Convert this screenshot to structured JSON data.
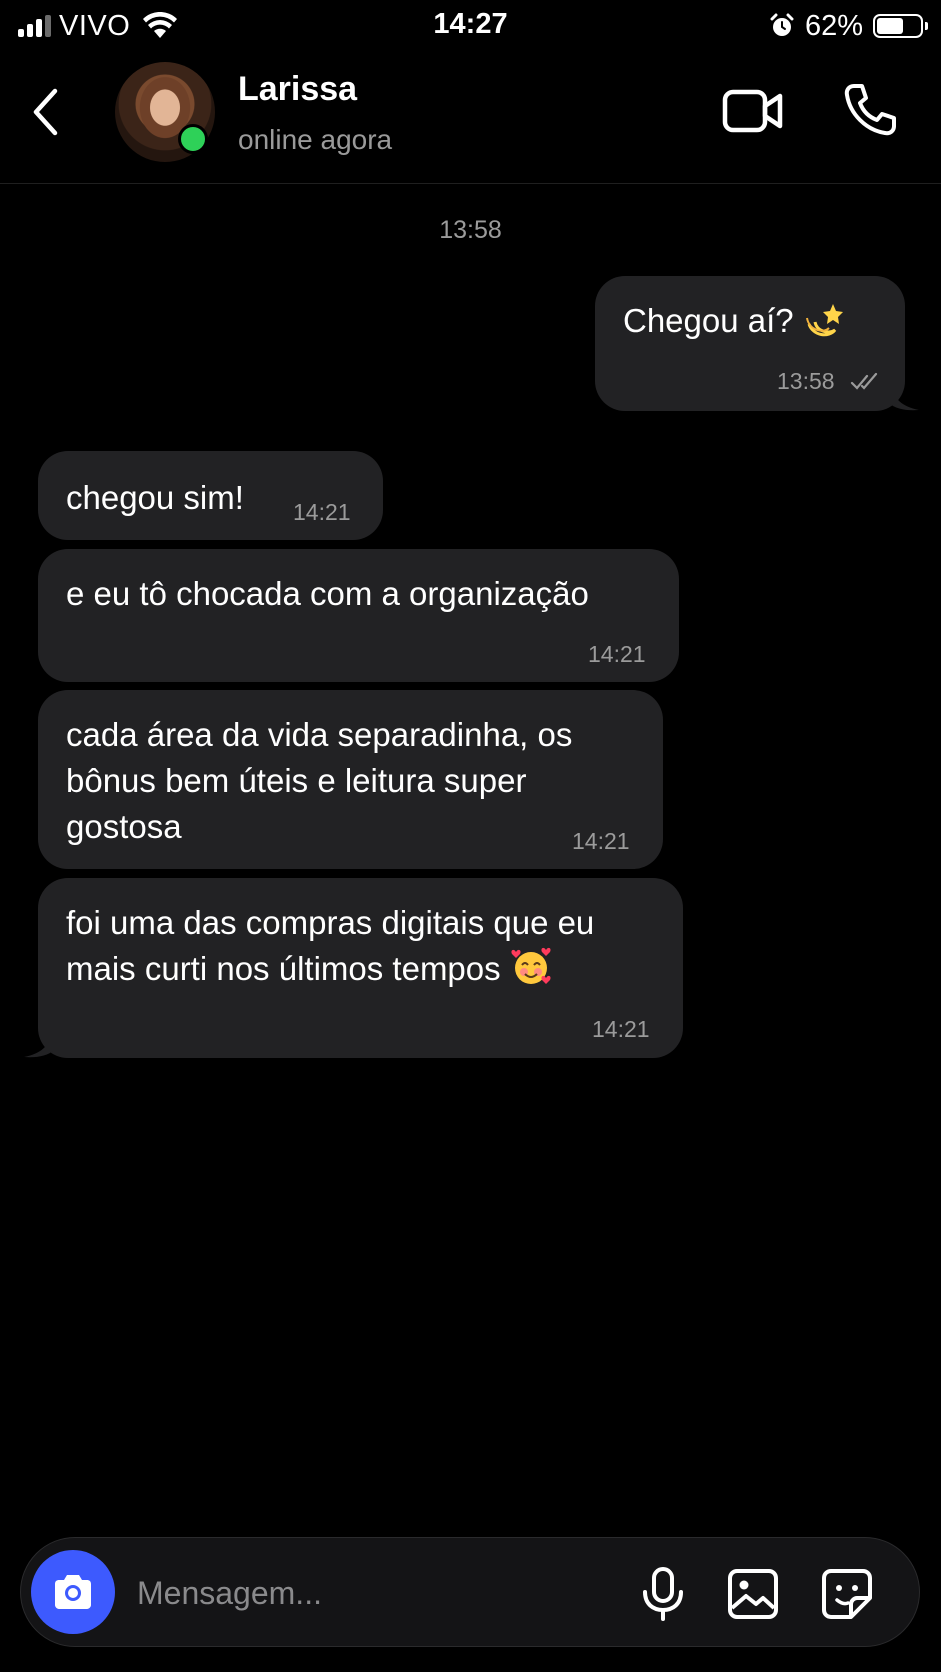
{
  "status_bar": {
    "carrier": "VIVO",
    "time": "14:27",
    "battery_percent": "62%",
    "battery_level": 0.62,
    "signal_bars": 3,
    "icons": [
      "signal-icon",
      "wifi-icon",
      "alarm-icon",
      "battery-icon"
    ]
  },
  "header": {
    "back_icon": "chevron-left-icon",
    "contact_name": "Larissa",
    "contact_status": "online agora",
    "video_icon": "video-camera-icon",
    "call_icon": "phone-icon"
  },
  "chat": {
    "date_separator": "13:58",
    "messages": [
      {
        "direction": "outgoing",
        "text": "Chegou aí?",
        "emoji": "💫",
        "time": "13:58",
        "status_icon": "double-check-icon"
      },
      {
        "direction": "incoming",
        "text": "chegou sim!",
        "time": "14:21"
      },
      {
        "direction": "incoming",
        "text": "e eu tô chocada com a organização",
        "time": "14:21"
      },
      {
        "direction": "incoming",
        "text": "cada área da vida separadinha, os bônus bem úteis e leitura super gostosa",
        "time": "14:21"
      },
      {
        "direction": "incoming",
        "text": "foi uma das compras digitais que eu mais curti nos últimos tempos",
        "emoji": "🥰",
        "time": "14:21"
      }
    ]
  },
  "composer": {
    "placeholder": "Mensagem...",
    "icons": [
      "camera-icon",
      "microphone-icon",
      "image-icon",
      "sticker-icon"
    ]
  },
  "colors": {
    "background": "#000000",
    "bubble": "#222224",
    "accent": "#3d5afe",
    "online": "#2ed158",
    "muted_text": "#9b9b9b"
  }
}
